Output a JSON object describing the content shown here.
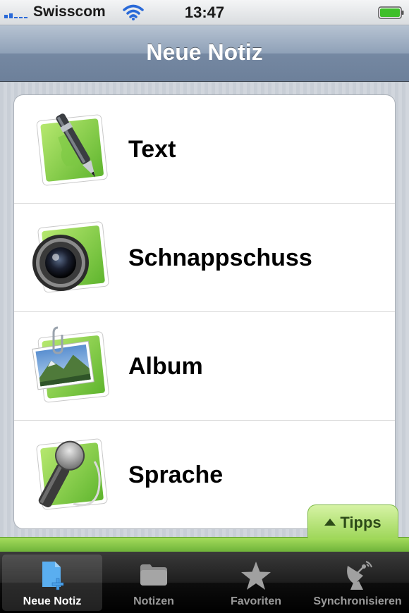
{
  "status_bar": {
    "carrier": "Swisscom",
    "time": "13:47",
    "signal_icon": "signal-bars-icon",
    "wifi_icon": "wifi-icon",
    "battery_icon": "battery-icon"
  },
  "nav": {
    "title": "Neue Notiz"
  },
  "list": {
    "items": [
      {
        "label": "Text",
        "icon": "pen-note-icon"
      },
      {
        "label": "Schnappschuss",
        "icon": "camera-note-icon"
      },
      {
        "label": "Album",
        "icon": "photo-album-note-icon"
      },
      {
        "label": "Sprache",
        "icon": "microphone-note-icon"
      }
    ]
  },
  "tipps": {
    "label": "Tipps",
    "icon": "triangle-up-icon"
  },
  "tabbar": {
    "tabs": [
      {
        "label": "Neue Notiz",
        "icon": "new-note-icon",
        "selected": true
      },
      {
        "label": "Notizen",
        "icon": "folder-icon",
        "selected": false
      },
      {
        "label": "Favoriten",
        "icon": "star-icon",
        "selected": false
      },
      {
        "label": "Synchronisieren",
        "icon": "satellite-dish-icon",
        "selected": false
      }
    ]
  },
  "colors": {
    "nav_gradient_top": "#b7c3d2",
    "nav_gradient_bottom": "#6d809a",
    "accent_green": "#8ccc4a",
    "tab_active_blue": "#4aa0e8"
  }
}
